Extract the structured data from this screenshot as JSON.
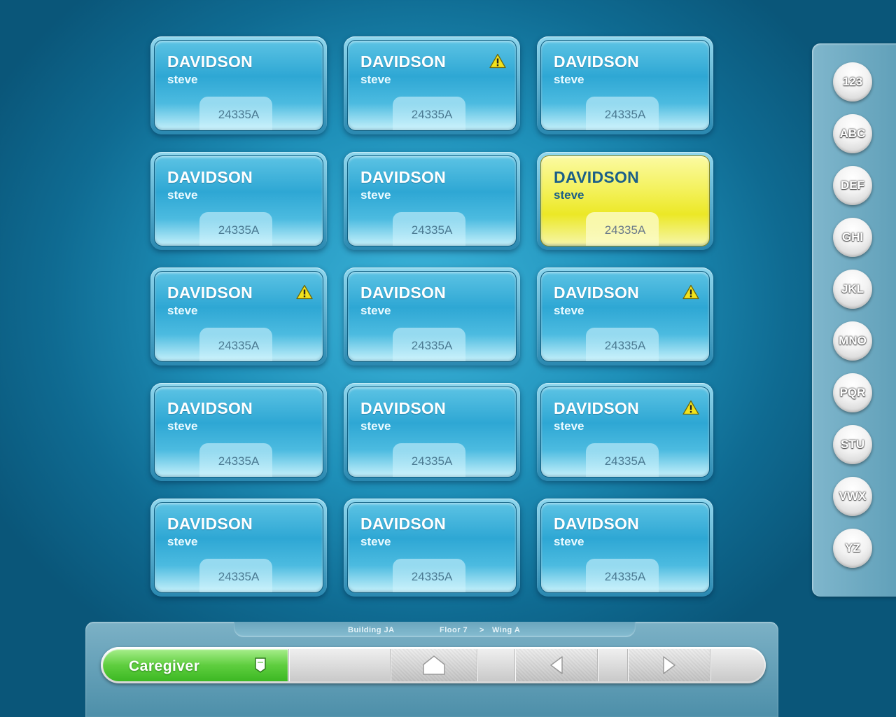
{
  "patients": [
    {
      "last_name": "DAVIDSON",
      "first_name": "steve",
      "id": "24335A",
      "alert": false,
      "selected": false
    },
    {
      "last_name": "DAVIDSON",
      "first_name": "steve",
      "id": "24335A",
      "alert": true,
      "selected": false
    },
    {
      "last_name": "DAVIDSON",
      "first_name": "steve",
      "id": "24335A",
      "alert": false,
      "selected": false
    },
    {
      "last_name": "DAVIDSON",
      "first_name": "steve",
      "id": "24335A",
      "alert": false,
      "selected": false
    },
    {
      "last_name": "DAVIDSON",
      "first_name": "steve",
      "id": "24335A",
      "alert": false,
      "selected": false
    },
    {
      "last_name": "DAVIDSON",
      "first_name": "steve",
      "id": "24335A",
      "alert": false,
      "selected": true
    },
    {
      "last_name": "DAVIDSON",
      "first_name": "steve",
      "id": "24335A",
      "alert": true,
      "selected": false
    },
    {
      "last_name": "DAVIDSON",
      "first_name": "steve",
      "id": "24335A",
      "alert": false,
      "selected": false
    },
    {
      "last_name": "DAVIDSON",
      "first_name": "steve",
      "id": "24335A",
      "alert": true,
      "selected": false
    },
    {
      "last_name": "DAVIDSON",
      "first_name": "steve",
      "id": "24335A",
      "alert": false,
      "selected": false
    },
    {
      "last_name": "DAVIDSON",
      "first_name": "steve",
      "id": "24335A",
      "alert": false,
      "selected": false
    },
    {
      "last_name": "DAVIDSON",
      "first_name": "steve",
      "id": "24335A",
      "alert": true,
      "selected": false
    },
    {
      "last_name": "DAVIDSON",
      "first_name": "steve",
      "id": "24335A",
      "alert": false,
      "selected": false
    },
    {
      "last_name": "DAVIDSON",
      "first_name": "steve",
      "id": "24335A",
      "alert": false,
      "selected": false
    },
    {
      "last_name": "DAVIDSON",
      "first_name": "steve",
      "id": "24335A",
      "alert": false,
      "selected": false
    }
  ],
  "alpha_index": [
    "123",
    "ABC",
    "DEF",
    "GHI",
    "JKL",
    "MNO",
    "PQR",
    "STU",
    "VWX",
    "YZ"
  ],
  "location": {
    "building": "Building JA",
    "floor": "Floor 7",
    "separator": ">",
    "wing": "Wing A"
  },
  "control_bar": {
    "caregiver_label": "Caregiver",
    "badge_icon": "id-badge-icon",
    "home_icon": "home-icon",
    "back_icon": "arrow-left-icon",
    "forward_icon": "arrow-right-icon"
  },
  "colors": {
    "alert": "#f2e21c",
    "selected_card": "#ece826",
    "caregiver_green": "#5fce3f",
    "card_blue": "#2ea7d4"
  }
}
